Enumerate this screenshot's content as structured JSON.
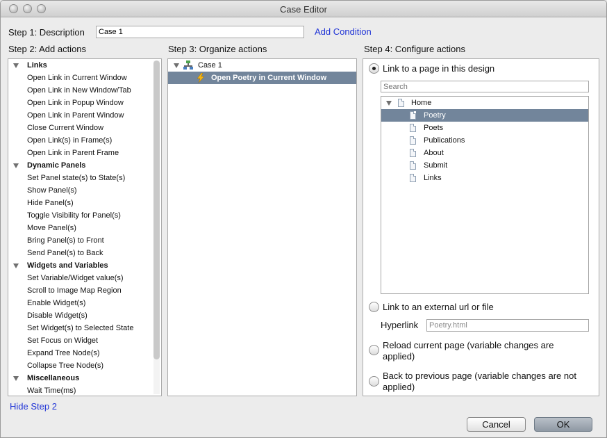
{
  "window": {
    "title": "Case Editor"
  },
  "step1": {
    "label": "Step 1: Description",
    "input_value": "Case 1",
    "add_condition": "Add Condition"
  },
  "step2": {
    "label": "Step 2: Add actions",
    "groups": [
      {
        "title": "Links",
        "items": [
          "Open Link in Current Window",
          "Open Link in New Window/Tab",
          "Open Link in Popup Window",
          "Open Link in Parent Window",
          "Close Current Window",
          "Open Link(s) in Frame(s)",
          "Open Link in Parent Frame"
        ]
      },
      {
        "title": "Dynamic Panels",
        "items": [
          "Set Panel state(s) to State(s)",
          "Show Panel(s)",
          "Hide Panel(s)",
          "Toggle Visibility for Panel(s)",
          "Move Panel(s)",
          "Bring Panel(s) to Front",
          "Send Panel(s) to Back"
        ]
      },
      {
        "title": "Widgets and Variables",
        "items": [
          "Set Variable/Widget value(s)",
          "Scroll to Image Map Region",
          "Enable Widget(s)",
          "Disable Widget(s)",
          "Set Widget(s) to Selected State",
          "Set Focus on Widget",
          "Expand Tree Node(s)",
          "Collapse Tree Node(s)"
        ]
      },
      {
        "title": "Miscellaneous",
        "items": [
          "Wait Time(ms)"
        ]
      }
    ],
    "hide_link": "Hide Step 2"
  },
  "step3": {
    "label": "Step 3: Organize actions",
    "case_name": "Case 1",
    "action": "Open Poetry in Current Window"
  },
  "step4": {
    "label": "Step 4: Configure actions",
    "option_page": "Link to a page in this design",
    "search_placeholder": "Search",
    "tree_root": "Home",
    "pages": [
      "Poetry",
      "Poets",
      "Publications",
      "About",
      "Submit",
      "Links"
    ],
    "option_external": "Link to an external url or file",
    "hyperlink_label": "Hyperlink",
    "hyperlink_value": "Poetry.html",
    "option_reload_1": "Reload current page (variable changes are",
    "option_reload_2": "applied)",
    "option_back_1": "Back to previous page (variable changes are not",
    "option_back_2": "applied)"
  },
  "buttons": {
    "cancel": "Cancel",
    "ok": "OK"
  },
  "colors": {
    "accent_link": "#1f33d6",
    "selection": "#72859b"
  }
}
